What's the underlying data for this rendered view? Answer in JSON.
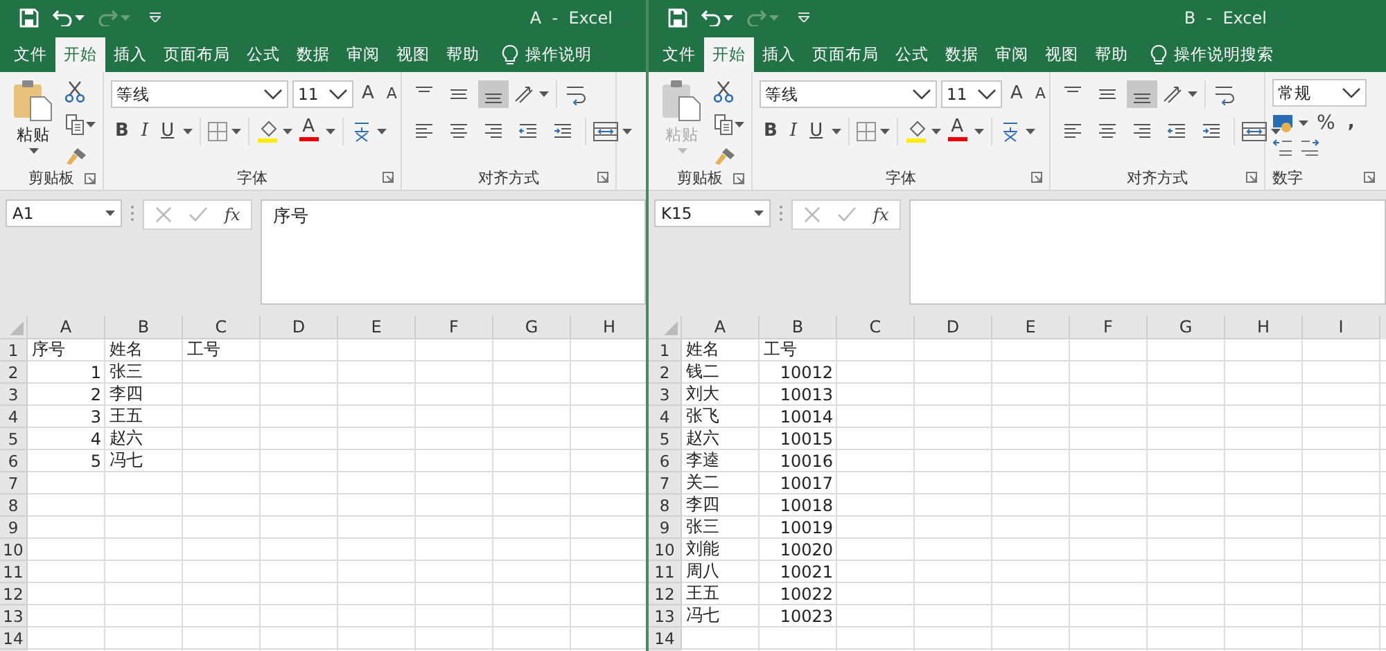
{
  "windows": [
    {
      "title": "A  -  Excel",
      "tabs": [
        {
          "label": "文件",
          "selected": false
        },
        {
          "label": "开始",
          "selected": true
        },
        {
          "label": "插入",
          "selected": false
        },
        {
          "label": "页面布局",
          "selected": false
        },
        {
          "label": "公式",
          "selected": false
        },
        {
          "label": "数据",
          "selected": false
        },
        {
          "label": "审阅",
          "selected": false
        },
        {
          "label": "视图",
          "selected": false
        },
        {
          "label": "帮助",
          "selected": false
        }
      ],
      "tell_me": "操作说明",
      "ribbon": {
        "clipboard": {
          "paste": "粘贴",
          "paste_disabled": false,
          "label": "剪贴板"
        },
        "font": {
          "name": "等线",
          "size": "11",
          "grow": "A",
          "shrink": "A",
          "bold": "B",
          "italic": "I",
          "underline": "U",
          "font_color": "A",
          "label": "字体"
        },
        "alignment": {
          "vertical": [
            {
              "selected": false
            },
            {
              "selected": false
            },
            {
              "selected": true
            }
          ],
          "label": "对齐方式"
        }
      },
      "name_box": "A1",
      "fx": "fx",
      "formula": "序号",
      "columns": [
        "A",
        "B",
        "C",
        "D",
        "E",
        "F",
        "G",
        "H"
      ],
      "rows": [
        {
          "header": "1",
          "cells": [
            {
              "text": "序号",
              "kind": "text"
            },
            {
              "text": "姓名",
              "kind": "text"
            },
            {
              "text": "工号",
              "kind": "text"
            }
          ]
        },
        {
          "header": "2",
          "cells": [
            {
              "text": "1",
              "kind": "number"
            },
            {
              "text": "张三",
              "kind": "text"
            }
          ]
        },
        {
          "header": "3",
          "cells": [
            {
              "text": "2",
              "kind": "number"
            },
            {
              "text": "李四",
              "kind": "text"
            }
          ]
        },
        {
          "header": "4",
          "cells": [
            {
              "text": "3",
              "kind": "number"
            },
            {
              "text": "王五",
              "kind": "text"
            }
          ]
        },
        {
          "header": "5",
          "cells": [
            {
              "text": "4",
              "kind": "number"
            },
            {
              "text": "赵六",
              "kind": "text"
            }
          ]
        },
        {
          "header": "6",
          "cells": [
            {
              "text": "5",
              "kind": "number"
            },
            {
              "text": "冯七",
              "kind": "text"
            }
          ]
        },
        {
          "header": "7",
          "cells": []
        },
        {
          "header": "8",
          "cells": []
        },
        {
          "header": "9",
          "cells": []
        },
        {
          "header": "10",
          "cells": []
        },
        {
          "header": "11",
          "cells": []
        },
        {
          "header": "12",
          "cells": []
        },
        {
          "header": "13",
          "cells": []
        },
        {
          "header": "14",
          "cells": []
        }
      ]
    },
    {
      "title": "B  -  Excel",
      "tabs": [
        {
          "label": "文件",
          "selected": false
        },
        {
          "label": "开始",
          "selected": true
        },
        {
          "label": "插入",
          "selected": false
        },
        {
          "label": "页面布局",
          "selected": false
        },
        {
          "label": "公式",
          "selected": false
        },
        {
          "label": "数据",
          "selected": false
        },
        {
          "label": "审阅",
          "selected": false
        },
        {
          "label": "视图",
          "selected": false
        },
        {
          "label": "帮助",
          "selected": false
        }
      ],
      "tell_me": "操作说明搜索",
      "ribbon": {
        "clipboard": {
          "paste": "粘贴",
          "paste_disabled": true,
          "label": "剪贴板"
        },
        "font": {
          "name": "等线",
          "size": "11",
          "grow": "A",
          "shrink": "A",
          "bold": "B",
          "italic": "I",
          "underline": "U",
          "font_color": "A",
          "label": "字体"
        },
        "alignment": {
          "vertical": [
            {
              "selected": false
            },
            {
              "selected": false
            },
            {
              "selected": true
            }
          ],
          "label": "对齐方式"
        },
        "number": {
          "format": "常规",
          "percent": "%",
          "comma": ",",
          "label": "数字"
        }
      },
      "name_box": "K15",
      "fx": "fx",
      "columns": [
        "A",
        "B",
        "C",
        "D",
        "E",
        "F",
        "G",
        "H",
        "I"
      ],
      "rows": [
        {
          "header": "1",
          "cells": [
            {
              "text": "姓名",
              "kind": "text"
            },
            {
              "text": "工号",
              "kind": "text"
            }
          ]
        },
        {
          "header": "2",
          "cells": [
            {
              "text": "钱二",
              "kind": "text"
            },
            {
              "text": "10012",
              "kind": "number"
            }
          ]
        },
        {
          "header": "3",
          "cells": [
            {
              "text": "刘大",
              "kind": "text"
            },
            {
              "text": "10013",
              "kind": "number"
            }
          ]
        },
        {
          "header": "4",
          "cells": [
            {
              "text": "张飞",
              "kind": "text"
            },
            {
              "text": "10014",
              "kind": "number"
            }
          ]
        },
        {
          "header": "5",
          "cells": [
            {
              "text": "赵六",
              "kind": "text"
            },
            {
              "text": "10015",
              "kind": "number"
            }
          ]
        },
        {
          "header": "6",
          "cells": [
            {
              "text": "李逵",
              "kind": "text"
            },
            {
              "text": "10016",
              "kind": "number"
            }
          ]
        },
        {
          "header": "7",
          "cells": [
            {
              "text": "关二",
              "kind": "text"
            },
            {
              "text": "10017",
              "kind": "number"
            }
          ]
        },
        {
          "header": "8",
          "cells": [
            {
              "text": "李四",
              "kind": "text"
            },
            {
              "text": "10018",
              "kind": "number"
            }
          ]
        },
        {
          "header": "9",
          "cells": [
            {
              "text": "张三",
              "kind": "text"
            },
            {
              "text": "10019",
              "kind": "number"
            }
          ]
        },
        {
          "header": "10",
          "cells": [
            {
              "text": "刘能",
              "kind": "text"
            },
            {
              "text": "10020",
              "kind": "number"
            }
          ]
        },
        {
          "header": "11",
          "cells": [
            {
              "text": "周八",
              "kind": "text"
            },
            {
              "text": "10021",
              "kind": "number"
            }
          ]
        },
        {
          "header": "12",
          "cells": [
            {
              "text": "王五",
              "kind": "text"
            },
            {
              "text": "10022",
              "kind": "number"
            }
          ]
        },
        {
          "header": "13",
          "cells": [
            {
              "text": "冯七",
              "kind": "text"
            },
            {
              "text": "10023",
              "kind": "number"
            }
          ]
        },
        {
          "header": "14",
          "cells": []
        }
      ]
    }
  ]
}
